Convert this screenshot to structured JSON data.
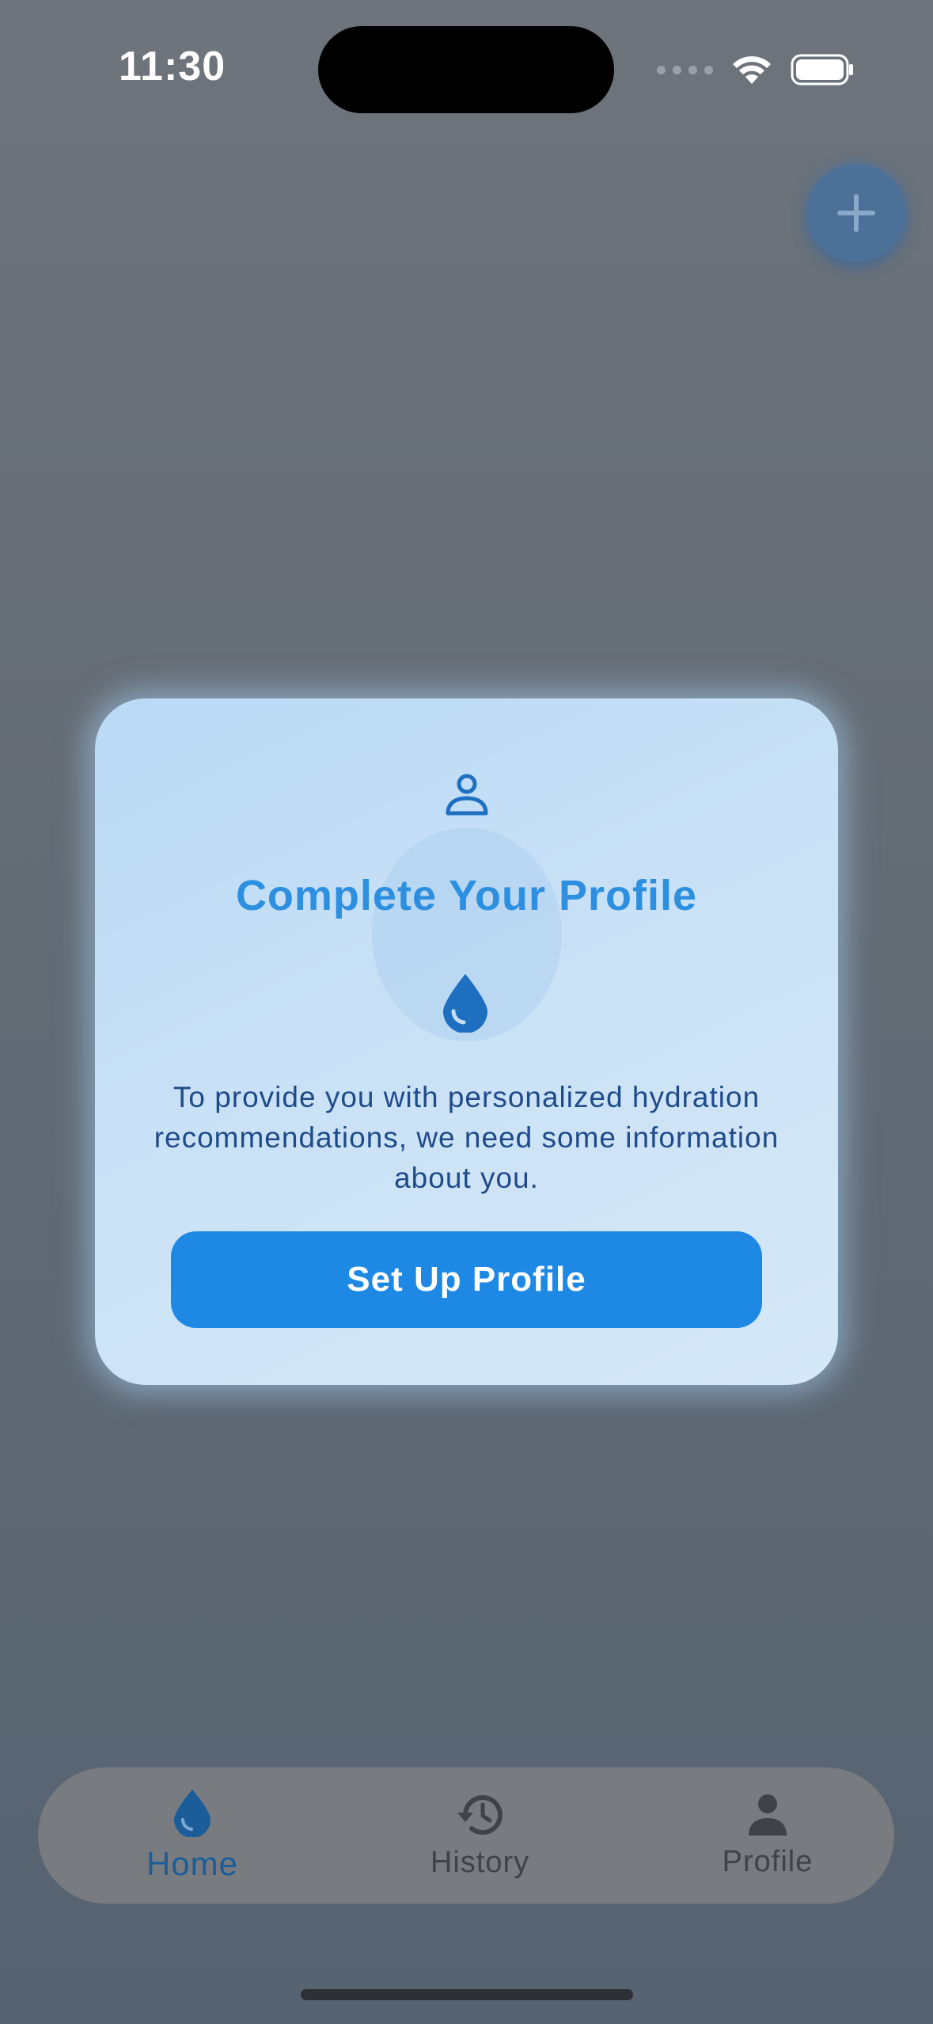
{
  "status_bar": {
    "time": "11:30",
    "icons": [
      "cellular-dots-icon",
      "wifi-icon",
      "battery-icon"
    ]
  },
  "header": {
    "add_button_icon": "plus-icon"
  },
  "modal": {
    "header_icon": "person-icon",
    "title": "Complete Your Profile",
    "drop_icon": "water-drop-icon",
    "message": "To provide you with personalized hydration recommendations, we need some information about you.",
    "button_label": "Set Up Profile"
  },
  "tab_bar": {
    "tabs": [
      {
        "label": "Home",
        "icon": "water-drop-icon",
        "active": true
      },
      {
        "label": "History",
        "icon": "history-icon",
        "active": false
      },
      {
        "label": "Profile",
        "icon": "person-icon",
        "active": false
      }
    ]
  },
  "colors": {
    "accent": "#1e88e5",
    "title_blue": "#2d8fe0",
    "message_blue": "#1f4b8a",
    "active_tab": "#1b5d99",
    "overlay": "#646c75",
    "card_background": "#c9e1f6"
  }
}
